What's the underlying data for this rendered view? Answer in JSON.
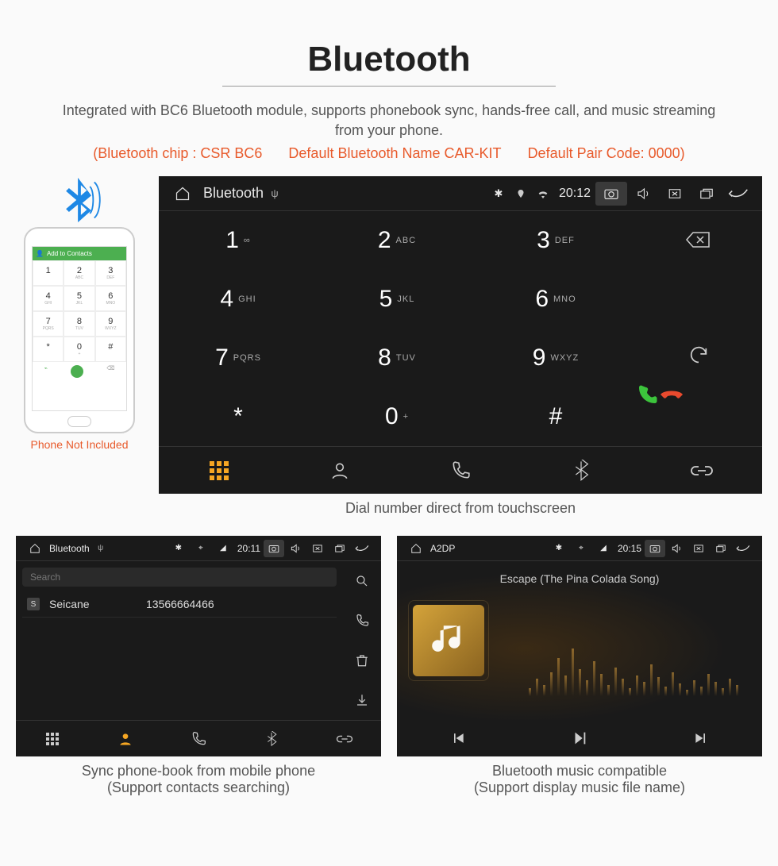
{
  "header": {
    "title": "Bluetooth",
    "description": "Integrated with BC6 Bluetooth module, supports phonebook sync, hands-free call, and music streaming from your phone.",
    "specs": {
      "chip": "(Bluetooth chip : CSR BC6",
      "name": "Default Bluetooth Name CAR-KIT",
      "code": "Default Pair Code: 0000)"
    }
  },
  "phone": {
    "header_label": "Add to Contacts",
    "caption": "Phone Not Included",
    "keys": [
      {
        "n": "1",
        "s": ""
      },
      {
        "n": "2",
        "s": "ABC"
      },
      {
        "n": "3",
        "s": "DEF"
      },
      {
        "n": "4",
        "s": "GHI"
      },
      {
        "n": "5",
        "s": "JKL"
      },
      {
        "n": "6",
        "s": "MNO"
      },
      {
        "n": "7",
        "s": "PQRS"
      },
      {
        "n": "8",
        "s": "TUV"
      },
      {
        "n": "9",
        "s": "WXYZ"
      },
      {
        "n": "*",
        "s": ""
      },
      {
        "n": "0",
        "s": "+"
      },
      {
        "n": "#",
        "s": ""
      }
    ]
  },
  "dialer": {
    "topbar": {
      "title": "Bluetooth",
      "time": "20:12"
    },
    "keys": [
      {
        "n": "1",
        "s": "∞"
      },
      {
        "n": "2",
        "s": "ABC"
      },
      {
        "n": "3",
        "s": "DEF"
      },
      {
        "n": "4",
        "s": "GHI"
      },
      {
        "n": "5",
        "s": "JKL"
      },
      {
        "n": "6",
        "s": "MNO"
      },
      {
        "n": "7",
        "s": "PQRS"
      },
      {
        "n": "8",
        "s": "TUV"
      },
      {
        "n": "9",
        "s": "WXYZ"
      },
      {
        "n": "*",
        "s": ""
      },
      {
        "n": "0",
        "s": "+"
      },
      {
        "n": "#",
        "s": ""
      }
    ],
    "caption": "Dial number direct from touchscreen"
  },
  "contacts": {
    "topbar": {
      "title": "Bluetooth",
      "time": "20:11"
    },
    "search_placeholder": "Search",
    "list": [
      {
        "tag": "S",
        "name": "Seicane",
        "number": "13566664466"
      }
    ],
    "caption_line1": "Sync phone-book from mobile phone",
    "caption_line2": "(Support contacts searching)"
  },
  "music": {
    "topbar": {
      "title": "A2DP",
      "time": "20:15"
    },
    "track": "Escape (The Pina Colada Song)",
    "caption_line1": "Bluetooth music compatible",
    "caption_line2": "(Support display music file name)"
  }
}
